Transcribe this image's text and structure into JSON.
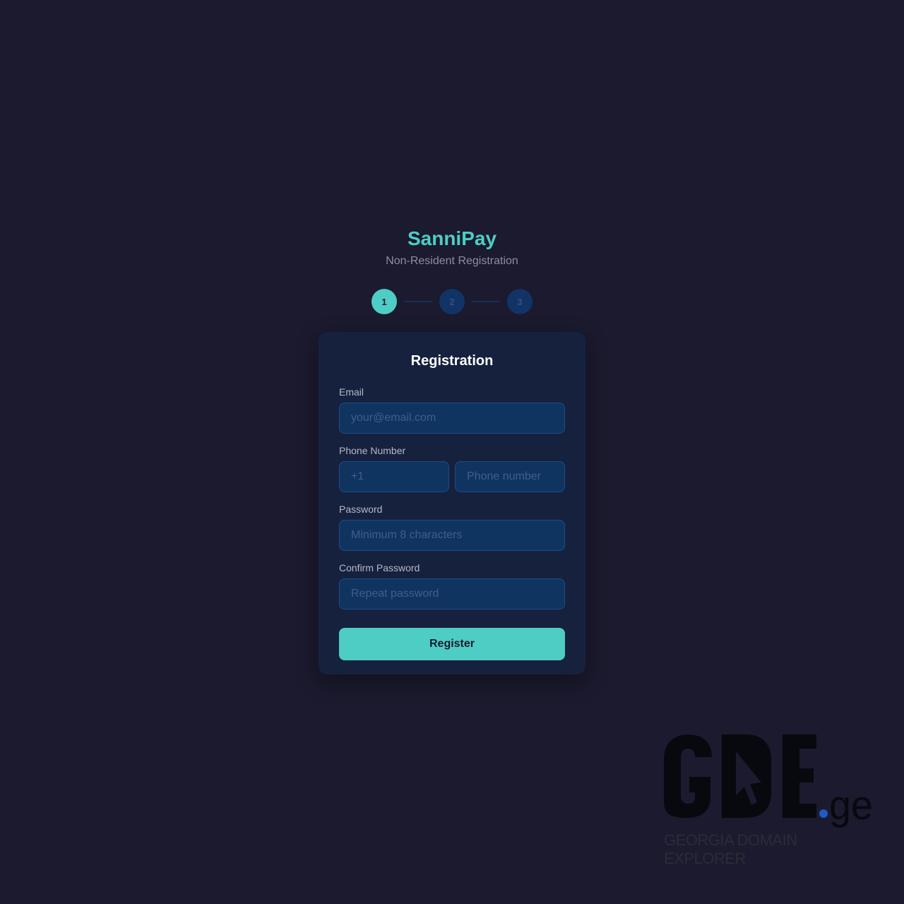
{
  "brand": {
    "title": "SanniPay",
    "subtitle": "Non-Resident Registration"
  },
  "stepper": {
    "steps": [
      "1",
      "2",
      "3"
    ],
    "active_step": 1
  },
  "form": {
    "title": "Registration",
    "email": {
      "label": "Email",
      "placeholder": "your@email.com",
      "value": ""
    },
    "phone": {
      "label": "Phone Number",
      "country_code_placeholder": "+1",
      "number_placeholder": "Phone number",
      "value": ""
    },
    "password": {
      "label": "Password",
      "placeholder": "Minimum 8 characters",
      "value": ""
    },
    "confirm_password": {
      "label": "Confirm Password",
      "placeholder": "Repeat password",
      "value": ""
    },
    "submit_label": "Register"
  },
  "watermark": {
    "logo_text": "GDE.ge",
    "tagline": "GEORGIA DOMAIN EXPLORER"
  },
  "colors": {
    "background": "#1b1a2e",
    "card": "#16213e",
    "input": "#0f3460",
    "accent": "#4ecdc4",
    "watermark_dot": "#1e5bc6"
  }
}
